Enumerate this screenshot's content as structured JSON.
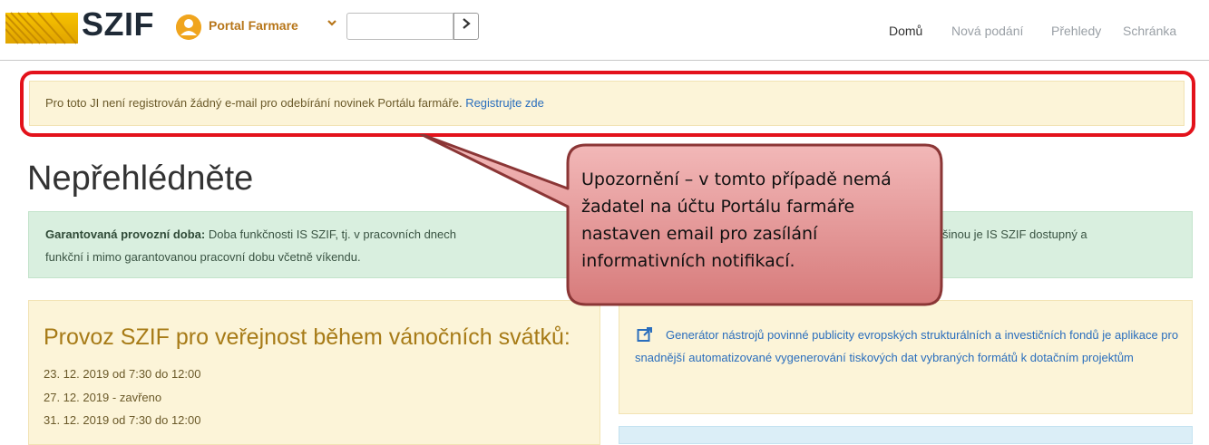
{
  "header": {
    "logo_text": "SZIF",
    "portal_name": "Portal Farmare",
    "search": {
      "value": "",
      "placeholder": ""
    },
    "nav": [
      {
        "label": "Domů"
      },
      {
        "label": "Nová podání"
      },
      {
        "label": "Přehledy"
      },
      {
        "label": "Schránka"
      }
    ]
  },
  "notice": {
    "text": "Pro toto JI není registrován žádný e-mail pro odebírání novinek Portálu farmáře. ",
    "link": "Registrujte zde"
  },
  "page": {
    "title": "Nepřehlédněte"
  },
  "green_box": {
    "bold": "Garantovaná provozní doba:",
    "line1": " Doba funkčnosti IS SZIF, tj. v pracovních dnech",
    "line1_end": "ě. Většinou je IS SZIF dostupný a",
    "line2": "funkční i mimo garantovanou pracovní dobu včetně víkendu."
  },
  "left_panel": {
    "title": "Provoz SZIF pro veřejnost během vánočních svátků:",
    "items": [
      "23. 12. 2019 od 7:30 do 12:00",
      "27. 12. 2019 - zavřeno",
      "31. 12. 2019 od 7:30 do 12:00"
    ]
  },
  "right_panel": {
    "link_text": "Generátor nástrojů povinné publicity evropských strukturálních a investičních fondů je aplikace pro snadnější automatizované vygenerování tiskových dat vybraných formátů k dotačním projektům"
  },
  "callout": {
    "text": "Upozornění – v tomto případě nemá žadatel na účtu Portálu farmáře nastaven email pro zasílání informativních notifikací."
  },
  "colors": {
    "accent_red": "#e3121b",
    "brand_orange": "#f0a51e",
    "link_blue": "#2a6ebd",
    "notice_bg": "#fcf4d8",
    "green_bg": "#d9efdf"
  }
}
